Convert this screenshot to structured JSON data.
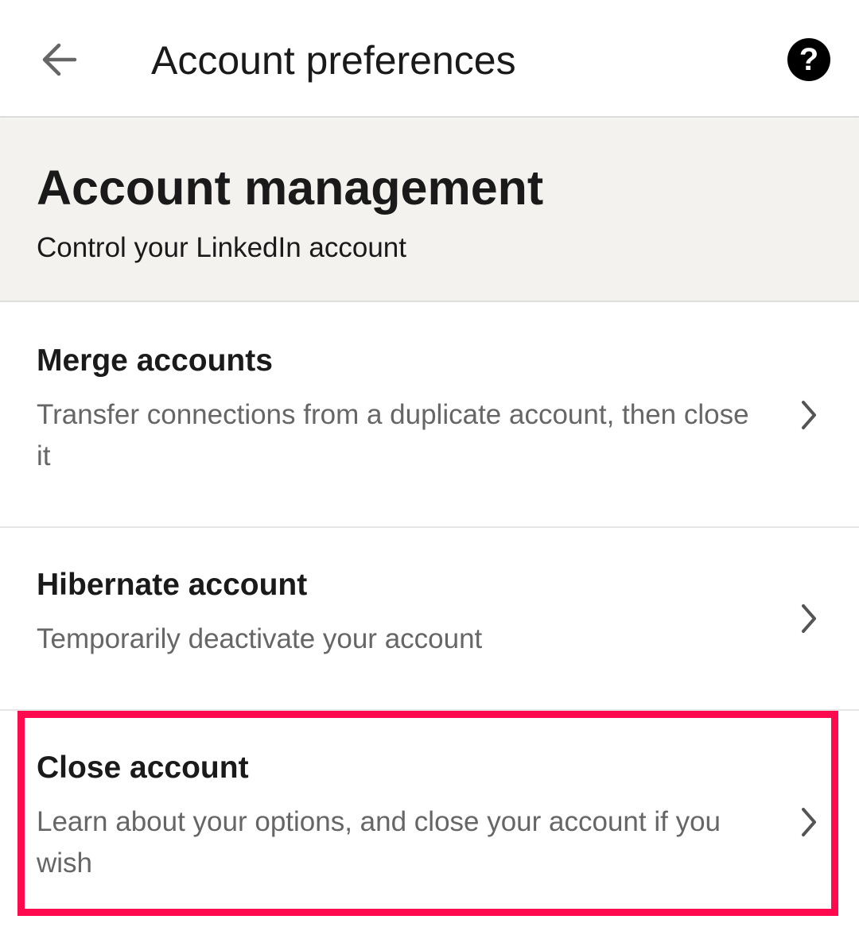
{
  "appbar": {
    "title": "Account preferences",
    "back_icon": "arrow-left-icon",
    "help_icon": "question-circle-icon",
    "help_glyph": "?"
  },
  "section": {
    "title": "Account management",
    "subtitle": "Control your LinkedIn account",
    "background": "#f3f2ef"
  },
  "items": [
    {
      "title": "Merge accounts",
      "description": "Transfer connections from a duplicate account, then close it",
      "icon": "chevron-right-icon"
    },
    {
      "title": "Hibernate account",
      "description": "Temporarily deactivate your account",
      "icon": "chevron-right-icon"
    },
    {
      "title": "Close account",
      "description": "Learn about your options, and close your account if you wish",
      "icon": "chevron-right-icon",
      "highlighted": true
    }
  ],
  "colors": {
    "highlight": "#ff0a4e",
    "text_primary": "#1a1a1a",
    "text_secondary": "#666666"
  }
}
